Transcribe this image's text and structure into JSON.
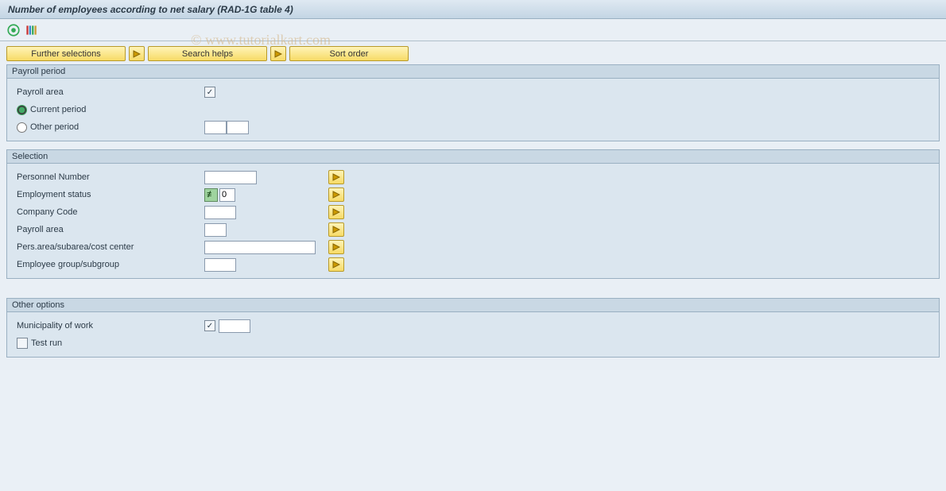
{
  "title": "Number of employees according to net salary (RAD-1G table 4)",
  "watermark": "© www.tutorialkart.com",
  "top_buttons": {
    "further_selections": "Further selections",
    "search_helps": "Search helps",
    "sort_order": "Sort order"
  },
  "groups": {
    "payroll_period": {
      "title": "Payroll period",
      "payroll_area_label": "Payroll area",
      "payroll_area_checked": true,
      "current_period_label": "Current period",
      "other_period_label": "Other period",
      "period_selected": "current"
    },
    "selection": {
      "title": "Selection",
      "rows": [
        {
          "label": "Personnel Number",
          "value": "",
          "width": "w66",
          "ne": false
        },
        {
          "label": "Employment status",
          "value": "0",
          "width": "w20",
          "ne": true
        },
        {
          "label": "Company Code",
          "value": "",
          "width": "w40",
          "ne": false
        },
        {
          "label": "Payroll area",
          "value": "",
          "width": "w28",
          "ne": false
        },
        {
          "label": "Pers.area/subarea/cost center",
          "value": "",
          "width": "w140",
          "ne": false
        },
        {
          "label": "Employee group/subgroup",
          "value": "",
          "width": "w40",
          "ne": false
        }
      ]
    },
    "other_options": {
      "title": "Other options",
      "municipality_label": "Municipality of work",
      "municipality_checked": true,
      "municipality_value": "",
      "test_run_label": "Test run",
      "test_run_checked": false
    }
  }
}
